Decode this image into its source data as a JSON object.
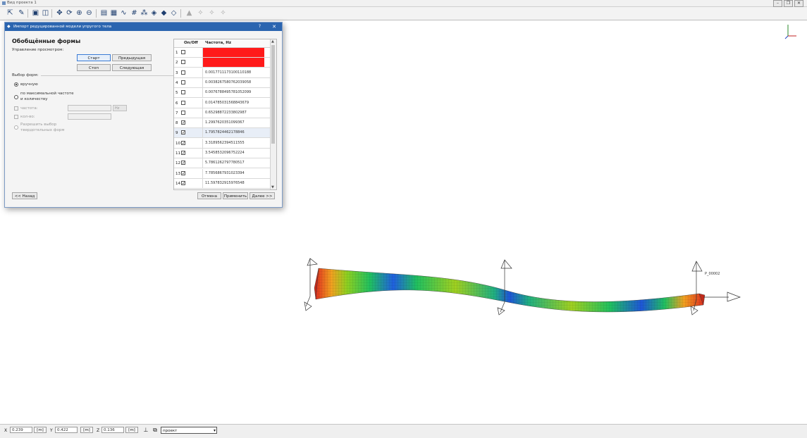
{
  "window": {
    "title": "Вид проекта 1"
  },
  "toolbar": {
    "icons": [
      "select-arrow-icon",
      "pen-icon",
      "view-frame-icon",
      "book-icon",
      "move-icon",
      "rotate-icon",
      "zoom-in-icon",
      "zoom-out-icon",
      "layout-icon",
      "grid-view-icon",
      "curve-icon",
      "mesh-icon",
      "nodes-icon",
      "shade-icon",
      "solid-icon",
      "wire-icon",
      "disabled-shape-icon",
      "disabled-tool-icon",
      "disabled-tool-icon",
      "disabled-tool-icon"
    ]
  },
  "dialog": {
    "title": "Импорт редуцированной модели упругого тела",
    "help": "?",
    "close": "✕",
    "heading": "Обобщённые формы",
    "view_control_label": "Управление просмотром:",
    "buttons": {
      "start": "Старт",
      "prev": "Предыдущая",
      "stop": "Стоп",
      "next": "Следующая"
    },
    "forms_label": "Выбор форм:",
    "radio_manual": "вручную",
    "radio_max_freq_l1": "по максимальной частоте",
    "radio_max_freq_l2": "и количеству",
    "chk_freq": "частота:",
    "chk_count": "кол-во:",
    "freq_unit": "Hz",
    "chk_allow_l1": "Разрешить выбор",
    "chk_allow_l2": "твердотельных форм",
    "back": "<< Назад",
    "cancel": "Отмена",
    "apply": "Применить",
    "forward": "Далее >>",
    "table": {
      "col_onoff": "On/Off",
      "col_freq": "Частота, Hz",
      "rows": [
        {
          "n": "1",
          "on": false,
          "freq": "",
          "red": true
        },
        {
          "n": "2",
          "on": false,
          "freq": "",
          "red": true
        },
        {
          "n": "3",
          "on": false,
          "freq": "0.0017711173100110188"
        },
        {
          "n": "4",
          "on": false,
          "freq": "0.0038267580762039058"
        },
        {
          "n": "5",
          "on": false,
          "freq": "0.0076788495781052099"
        },
        {
          "n": "6",
          "on": false,
          "freq": "0.014785031568843679"
        },
        {
          "n": "7",
          "on": false,
          "freq": "0.65298872233802987"
        },
        {
          "n": "8",
          "on": true,
          "freq": "1.2997620351099367"
        },
        {
          "n": "9",
          "on": true,
          "freq": "1.7957824462178846",
          "sel": true
        },
        {
          "n": "10",
          "on": true,
          "freq": "3.3189562394511555"
        },
        {
          "n": "11",
          "on": true,
          "freq": "3.5458532096752224"
        },
        {
          "n": "12",
          "on": true,
          "freq": "5.7861262797780517"
        },
        {
          "n": "13",
          "on": true,
          "freq": "7.7856867931023394"
        },
        {
          "n": "14",
          "on": true,
          "freq": "11.597832915976548"
        }
      ]
    }
  },
  "viewport": {
    "node_label": "P_00002"
  },
  "status": {
    "x_label": "X",
    "x_value": "0.239",
    "x_unit": "[m]",
    "y_label": "Y",
    "y_value": "0.422",
    "y_unit": "[m]",
    "z_label": "Z",
    "z_value": "0.136",
    "z_unit": "[m]",
    "mode": "проект"
  }
}
